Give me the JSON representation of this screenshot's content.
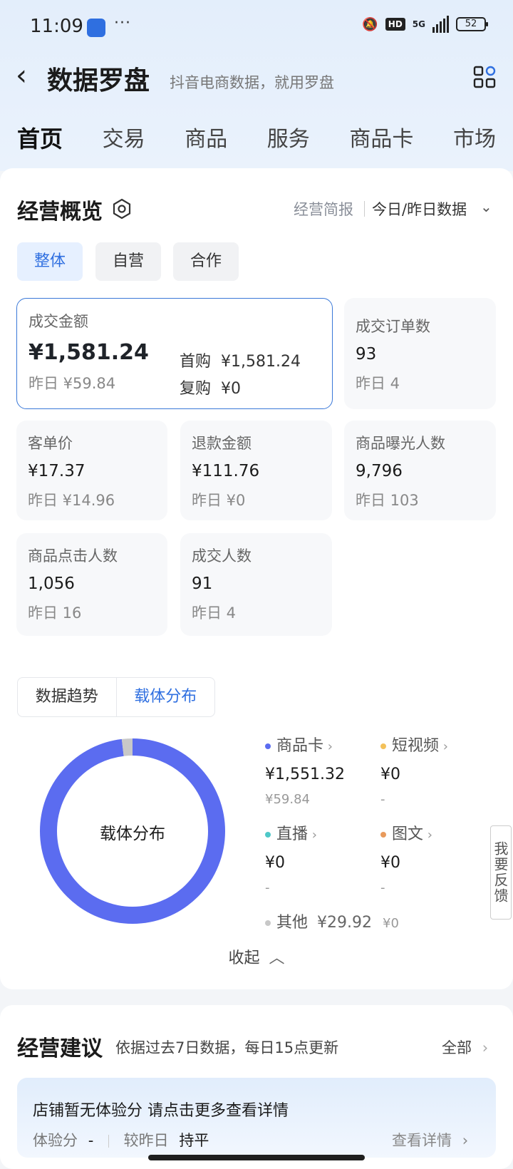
{
  "status": {
    "time": "11:09",
    "dots": "···",
    "hd": "HD",
    "net": "5G",
    "battery": "52"
  },
  "header": {
    "back": "‹",
    "title": "数据罗盘",
    "subtitle": "抖音电商数据，就用罗盘"
  },
  "tabs": [
    "首页",
    "交易",
    "商品",
    "服务",
    "商品卡",
    "市场"
  ],
  "overview": {
    "title": "经营概览",
    "brief": "经营简报",
    "range": "今日/昨日数据",
    "segments": [
      "整体",
      "自营",
      "合作"
    ],
    "sales": {
      "label": "成交金额",
      "value": "¥1,581.24",
      "yesterday": "昨日 ¥59.84",
      "first_label": "首购",
      "first_value": "¥1,581.24",
      "repeat_label": "复购",
      "repeat_value": "¥0"
    },
    "orders": {
      "label": "成交订单数",
      "value": "93",
      "yesterday": "昨日 4"
    },
    "aov": {
      "label": "客单价",
      "value": "¥17.37",
      "yesterday": "昨日 ¥14.96"
    },
    "refund": {
      "label": "退款金额",
      "value": "¥111.76",
      "yesterday": "昨日 ¥0"
    },
    "exposure": {
      "label": "商品曝光人数",
      "value": "9,796",
      "yesterday": "昨日 103"
    },
    "clicks": {
      "label": "商品点击人数",
      "value": "1,056",
      "yesterday": "昨日 16"
    },
    "buyers": {
      "label": "成交人数",
      "value": "91",
      "yesterday": "昨日 4"
    }
  },
  "carrier": {
    "toggle": [
      "数据趋势",
      "载体分布"
    ],
    "donut_center": "载体分布",
    "product_card": {
      "name": "商品卡",
      "value": "¥1,551.32",
      "sub": "¥59.84",
      "color": "#5b6cf0",
      "share": 0.981
    },
    "short_video": {
      "name": "短视频",
      "value": "¥0",
      "sub": "-",
      "color": "#f3c15a"
    },
    "live": {
      "name": "直播",
      "value": "¥0",
      "sub": "-",
      "color": "#4fc8c8"
    },
    "graphic": {
      "name": "图文",
      "value": "¥0",
      "sub": "-",
      "color": "#e89a5c"
    },
    "other": {
      "name": "其他",
      "value": "¥29.92",
      "sub": "¥0",
      "color": "#c8c8c8",
      "share": 0.019
    },
    "collapse": "收起",
    "feedback": "我要反馈"
  },
  "advice": {
    "title": "经营建议",
    "desc": "依据过去7日数据，每日15点更新",
    "all": "全部",
    "tip": "店铺暂无体验分 请点击更多查看详情",
    "score_label": "体验分",
    "score_value": "-",
    "compare_label": "较昨日",
    "compare_value": "持平",
    "detail": "查看详情"
  }
}
